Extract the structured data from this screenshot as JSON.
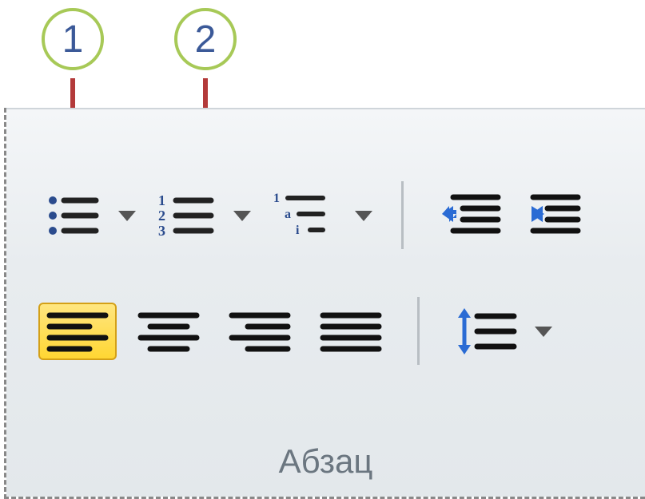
{
  "callouts": {
    "one": "1",
    "two": "2"
  },
  "group_label": "Абзац",
  "colors": {
    "accent": "#2a4b8d",
    "callout_ring": "#a7c957",
    "callout_stick": "#b33a3a",
    "selected_fill": "#ffd633"
  }
}
